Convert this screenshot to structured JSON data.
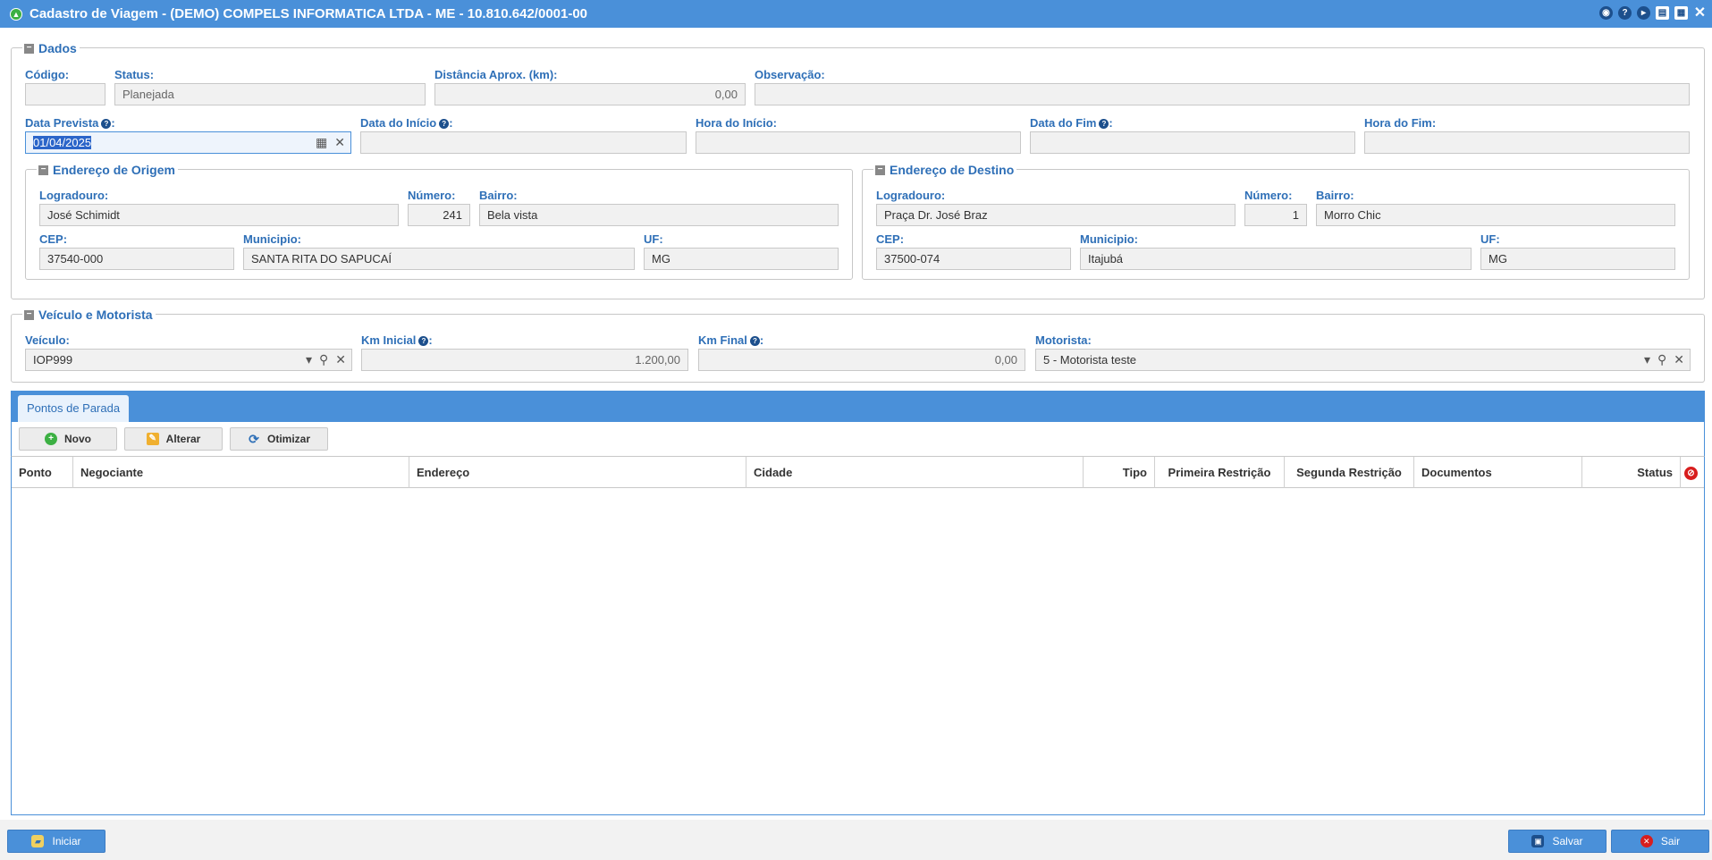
{
  "window": {
    "title": "Cadastro de Viagem - (DEMO) COMPELS INFORMATICA LTDA - ME - 10.810.642/0001-00",
    "icons": [
      "eye-icon",
      "help-icon",
      "play-icon",
      "print-icon",
      "calendar-icon",
      "close-icon"
    ]
  },
  "dados": {
    "legend": "Dados",
    "codigo": {
      "label": "Código:",
      "value": ""
    },
    "status": {
      "label": "Status:",
      "value": "Planejada"
    },
    "distancia": {
      "label": "Distância Aprox. (km):",
      "value": "0,00"
    },
    "observacao": {
      "label": "Observação:",
      "value": ""
    },
    "data_prevista": {
      "label": "Data Prevista",
      "value": "01/04/2025"
    },
    "data_inicio": {
      "label": "Data do Início",
      "value": ""
    },
    "hora_inicio": {
      "label": "Hora do Início:",
      "value": ""
    },
    "data_fim": {
      "label": "Data do Fim",
      "value": ""
    },
    "hora_fim": {
      "label": "Hora do Fim:",
      "value": ""
    },
    "help_glyph": "?"
  },
  "origem": {
    "legend": "Endereço de Origem",
    "logradouro": {
      "label": "Logradouro:",
      "value": "José Schimidt"
    },
    "numero": {
      "label": "Número:",
      "value": "241"
    },
    "bairro": {
      "label": "Bairro:",
      "value": "Bela vista"
    },
    "cep": {
      "label": "CEP:",
      "value": "37540-000"
    },
    "municipio": {
      "label": "Municipio:",
      "value": "SANTA RITA DO SAPUCAÍ"
    },
    "uf": {
      "label": "UF:",
      "value": "MG"
    }
  },
  "destino": {
    "legend": "Endereço de Destino",
    "logradouro": {
      "label": "Logradouro:",
      "value": "Praça Dr. José Braz"
    },
    "numero": {
      "label": "Número:",
      "value": "1"
    },
    "bairro": {
      "label": "Bairro:",
      "value": "Morro Chic"
    },
    "cep": {
      "label": "CEP:",
      "value": "37500-074"
    },
    "municipio": {
      "label": "Municipio:",
      "value": "Itajubá"
    },
    "uf": {
      "label": "UF:",
      "value": "MG"
    }
  },
  "veiculo_motorista": {
    "legend": "Veículo e Motorista",
    "veiculo": {
      "label": "Veículo:",
      "value": "IOP999"
    },
    "km_inicial": {
      "label": "Km Inicial",
      "value": "1.200,00"
    },
    "km_final": {
      "label": "Km Final",
      "value": "0,00"
    },
    "motorista": {
      "label": "Motorista:",
      "value": "5 - Motorista teste"
    }
  },
  "pontos": {
    "tab_label": "Pontos de Parada",
    "buttons": {
      "novo": "Novo",
      "alterar": "Alterar",
      "otimizar": "Otimizar"
    },
    "columns": [
      "Ponto",
      "Negociante",
      "Endereço",
      "Cidade",
      "Tipo",
      "Primeira Restrição",
      "Segunda Restrição",
      "Documentos",
      "Status"
    ]
  },
  "footer": {
    "iniciar": "Iniciar",
    "salvar": "Salvar",
    "sair": "Sair"
  },
  "colors": {
    "accent": "#4a90d9",
    "label": "#2e6fb7",
    "field_bg": "#f1f1f1"
  }
}
